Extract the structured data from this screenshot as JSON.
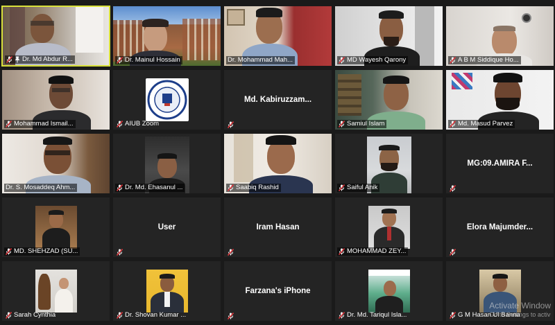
{
  "participants": [
    {
      "name": "Dr. Md Abdur R...",
      "style": "video",
      "pinned": true
    },
    {
      "name": "Dr. Mainul Hossain",
      "style": "video"
    },
    {
      "name": "Dr. Mohammad Mah...",
      "style": "video"
    },
    {
      "name": "MD Wayesh Qarony",
      "style": "video"
    },
    {
      "name": "A B M Siddique Ho...",
      "style": "video"
    },
    {
      "name": "Mohammad Ismail...",
      "style": "video"
    },
    {
      "name": "AIUB Zoom",
      "style": "logo"
    },
    {
      "name": "Md. Kabiruzzam...",
      "style": "name"
    },
    {
      "name": "Samiul Islam",
      "style": "video"
    },
    {
      "name": "Md. Masud Parvez",
      "style": "video"
    },
    {
      "name": "Dr. S. Mosaddeq Ahm...",
      "style": "video"
    },
    {
      "name": "Dr. Md. Ehasanul ...",
      "style": "photo"
    },
    {
      "name": "Saabiq Rashid",
      "style": "video"
    },
    {
      "name": "Saiful Anik",
      "style": "photo"
    },
    {
      "name": "MG:09.AMIRA F...",
      "style": "name"
    },
    {
      "name": "MD. SHEHZAD (SU...",
      "style": "photo"
    },
    {
      "name": "User",
      "style": "name"
    },
    {
      "name": "Iram Hasan",
      "style": "name"
    },
    {
      "name": "MOHAMMAD ZEY...",
      "style": "photo"
    },
    {
      "name": "Elora Majumder...",
      "style": "name"
    },
    {
      "name": "Sarah Cynthia",
      "style": "photo"
    },
    {
      "name": "Dr. Shovan Kumar ...",
      "style": "photo"
    },
    {
      "name": "Farzana's iPhone",
      "style": "name"
    },
    {
      "name": "Dr. Md. Tariqul Isla...",
      "style": "photo"
    },
    {
      "name": "G M Hasan Ul Banna",
      "style": "photo"
    }
  ],
  "watermark": {
    "line1": "Activate Window",
    "line2": "Go to Settings to activ"
  },
  "colors": {
    "active_border": "#d9e13a",
    "tile_bg": "#242424",
    "muted_icon": "#e0393e"
  }
}
